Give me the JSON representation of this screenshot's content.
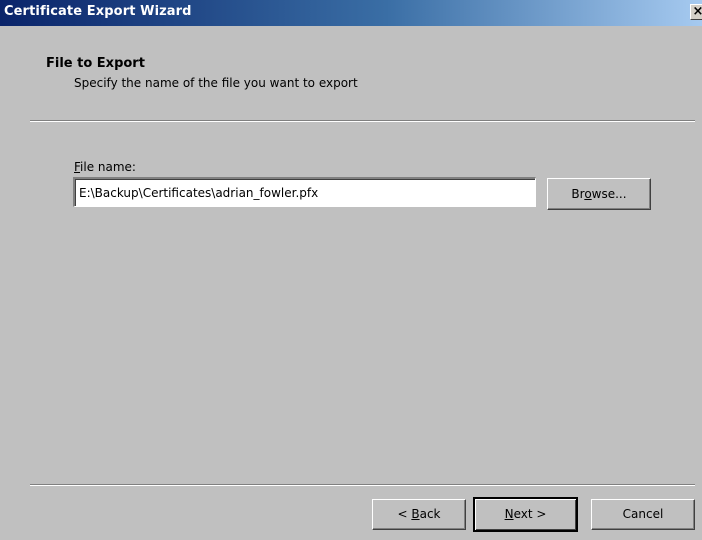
{
  "window": {
    "title": "Certificate Export Wizard",
    "close_glyph": "✕"
  },
  "header": {
    "title": "File to Export",
    "subtitle": "Specify the name of the file you want to export"
  },
  "form": {
    "file_label_mnemonic": "F",
    "file_label_rest": "ile name:",
    "file_value": "E:\\Backup\\Certificates\\adrian_fowler.pfx",
    "browse_pre": "Br",
    "browse_mnemonic": "o",
    "browse_post": "wse..."
  },
  "buttons": {
    "back_pre": "< ",
    "back_mnemonic": "B",
    "back_post": "ack",
    "next_mnemonic": "N",
    "next_post": "ext >",
    "cancel": "Cancel"
  },
  "colors": {
    "titlebar_start": "#0a246a",
    "titlebar_end": "#a6caf0",
    "dialog_face": "#c0c0c0"
  }
}
